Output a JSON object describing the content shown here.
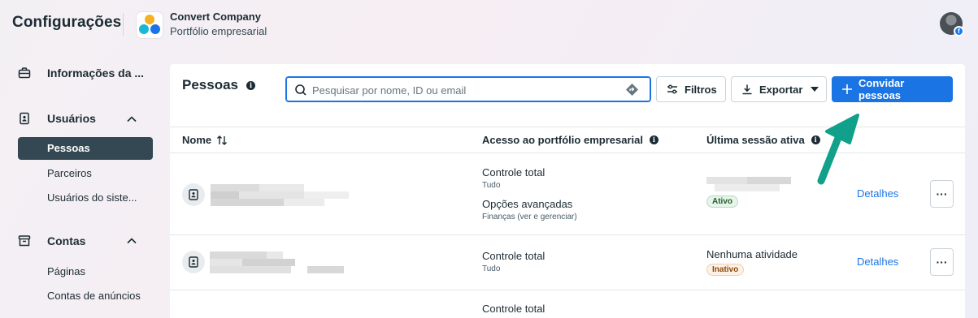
{
  "header": {
    "app_title": "Configurações",
    "company_name": "Convert Company",
    "company_subtitle": "Portfólio empresarial"
  },
  "sidebar": {
    "sections": [
      {
        "label": "Informações da ...",
        "icon": "briefcase-icon"
      },
      {
        "label": "Usuários",
        "icon": "user-badge-icon",
        "expanded": true
      },
      {
        "label": "Contas",
        "icon": "archive-icon",
        "expanded": true
      }
    ],
    "items": [
      {
        "label": "Pessoas",
        "active": true
      },
      {
        "label": "Parceiros"
      },
      {
        "label": "Usuários do siste..."
      },
      {
        "label": "Páginas"
      },
      {
        "label": "Contas de anúncios"
      }
    ]
  },
  "main": {
    "title": "Pessoas",
    "search": {
      "placeholder": "Pesquisar por nome, ID ou email",
      "value": ""
    },
    "buttons": {
      "filters": "Filtros",
      "export": "Exportar",
      "invite": "Convidar pessoas"
    },
    "columns": [
      "Nome",
      "Acesso ao portfólio empresarial",
      "Última sessão ativa"
    ],
    "rows": [
      {
        "access": [
          {
            "title": "Controle total",
            "sub": "Tudo"
          },
          {
            "title": "Opções avançadas",
            "sub": "Finanças (ver e gerenciar)"
          }
        ],
        "status": "Ativo",
        "details": "Detalhes",
        "more": "···"
      },
      {
        "access": [
          {
            "title": "Controle total",
            "sub": "Tudo"
          }
        ],
        "activity": "Nenhuma atividade",
        "status": "Inativo",
        "details": "Detalhes",
        "more": "···"
      },
      {
        "access": [
          {
            "title": "Controle total"
          }
        ]
      }
    ]
  },
  "colors": {
    "accent": "#1b74e4",
    "active_nav": "#344854",
    "annotation_arrow": "#11a08a"
  }
}
